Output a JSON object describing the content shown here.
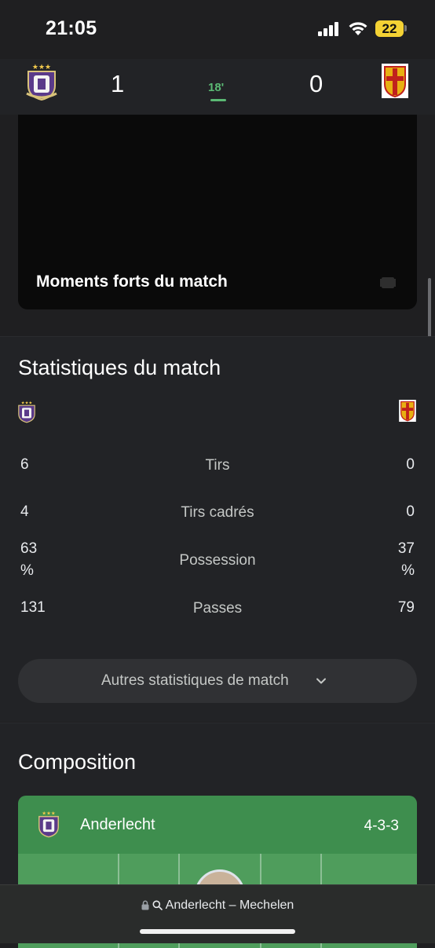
{
  "status_bar": {
    "time": "21:05",
    "battery_level": "22"
  },
  "header": {
    "home_score": "1",
    "away_score": "0",
    "minute": "18'"
  },
  "highlights": {
    "title": "Moments forts du match"
  },
  "stats": {
    "title": "Statistiques du match",
    "rows": [
      {
        "home": "6",
        "name": "Tirs",
        "away": "0"
      },
      {
        "home": "4",
        "name": "Tirs cadrés",
        "away": "0"
      },
      {
        "home": "63\n%",
        "name": "Possession",
        "away": "37\n%"
      },
      {
        "home": "131",
        "name": "Passes",
        "away": "79"
      }
    ],
    "more_label": "Autres statistiques de match"
  },
  "composition": {
    "title": "Composition",
    "team_name": "Anderlecht",
    "formation": "4-3-3"
  },
  "browser": {
    "url_text": "Anderlecht – Mechelen"
  },
  "colors": {
    "accent_green": "#5bb974",
    "pitch_green": "#4f9d5c",
    "team_bar_green": "#3e8e4e",
    "anderlecht_purple": "#5a3a8a"
  }
}
